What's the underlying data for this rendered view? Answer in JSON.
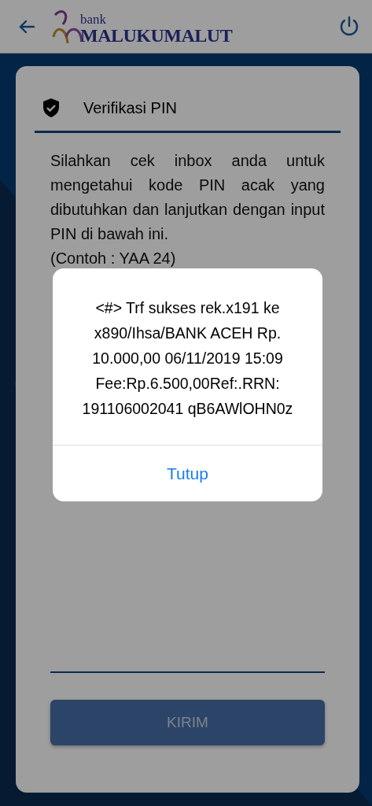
{
  "header": {
    "logo_small": "bank",
    "logo_large": "MALUKUMALUT"
  },
  "card": {
    "title": "Verifikasi PIN",
    "instructions": "Silahkan cek inbox anda untuk mengetahui kode PIN acak yang dibutuhkan dan lanjutkan dengan input PIN di bawah ini.",
    "example": "(Contoh : YAA 24)",
    "submit": {
      "label": "KIRIM",
      "disabled": true
    }
  },
  "alert": {
    "message": "<#> Trf sukses rek.x191 ke\nx890/Ihsa/BANK ACEH Rp.\n10.000,00 06/11/2019 15:09\nFee:Rp.6.500,00Ref:.RRN:\n191106002041 qB6AWlOHN0z",
    "button": "Tutup"
  }
}
